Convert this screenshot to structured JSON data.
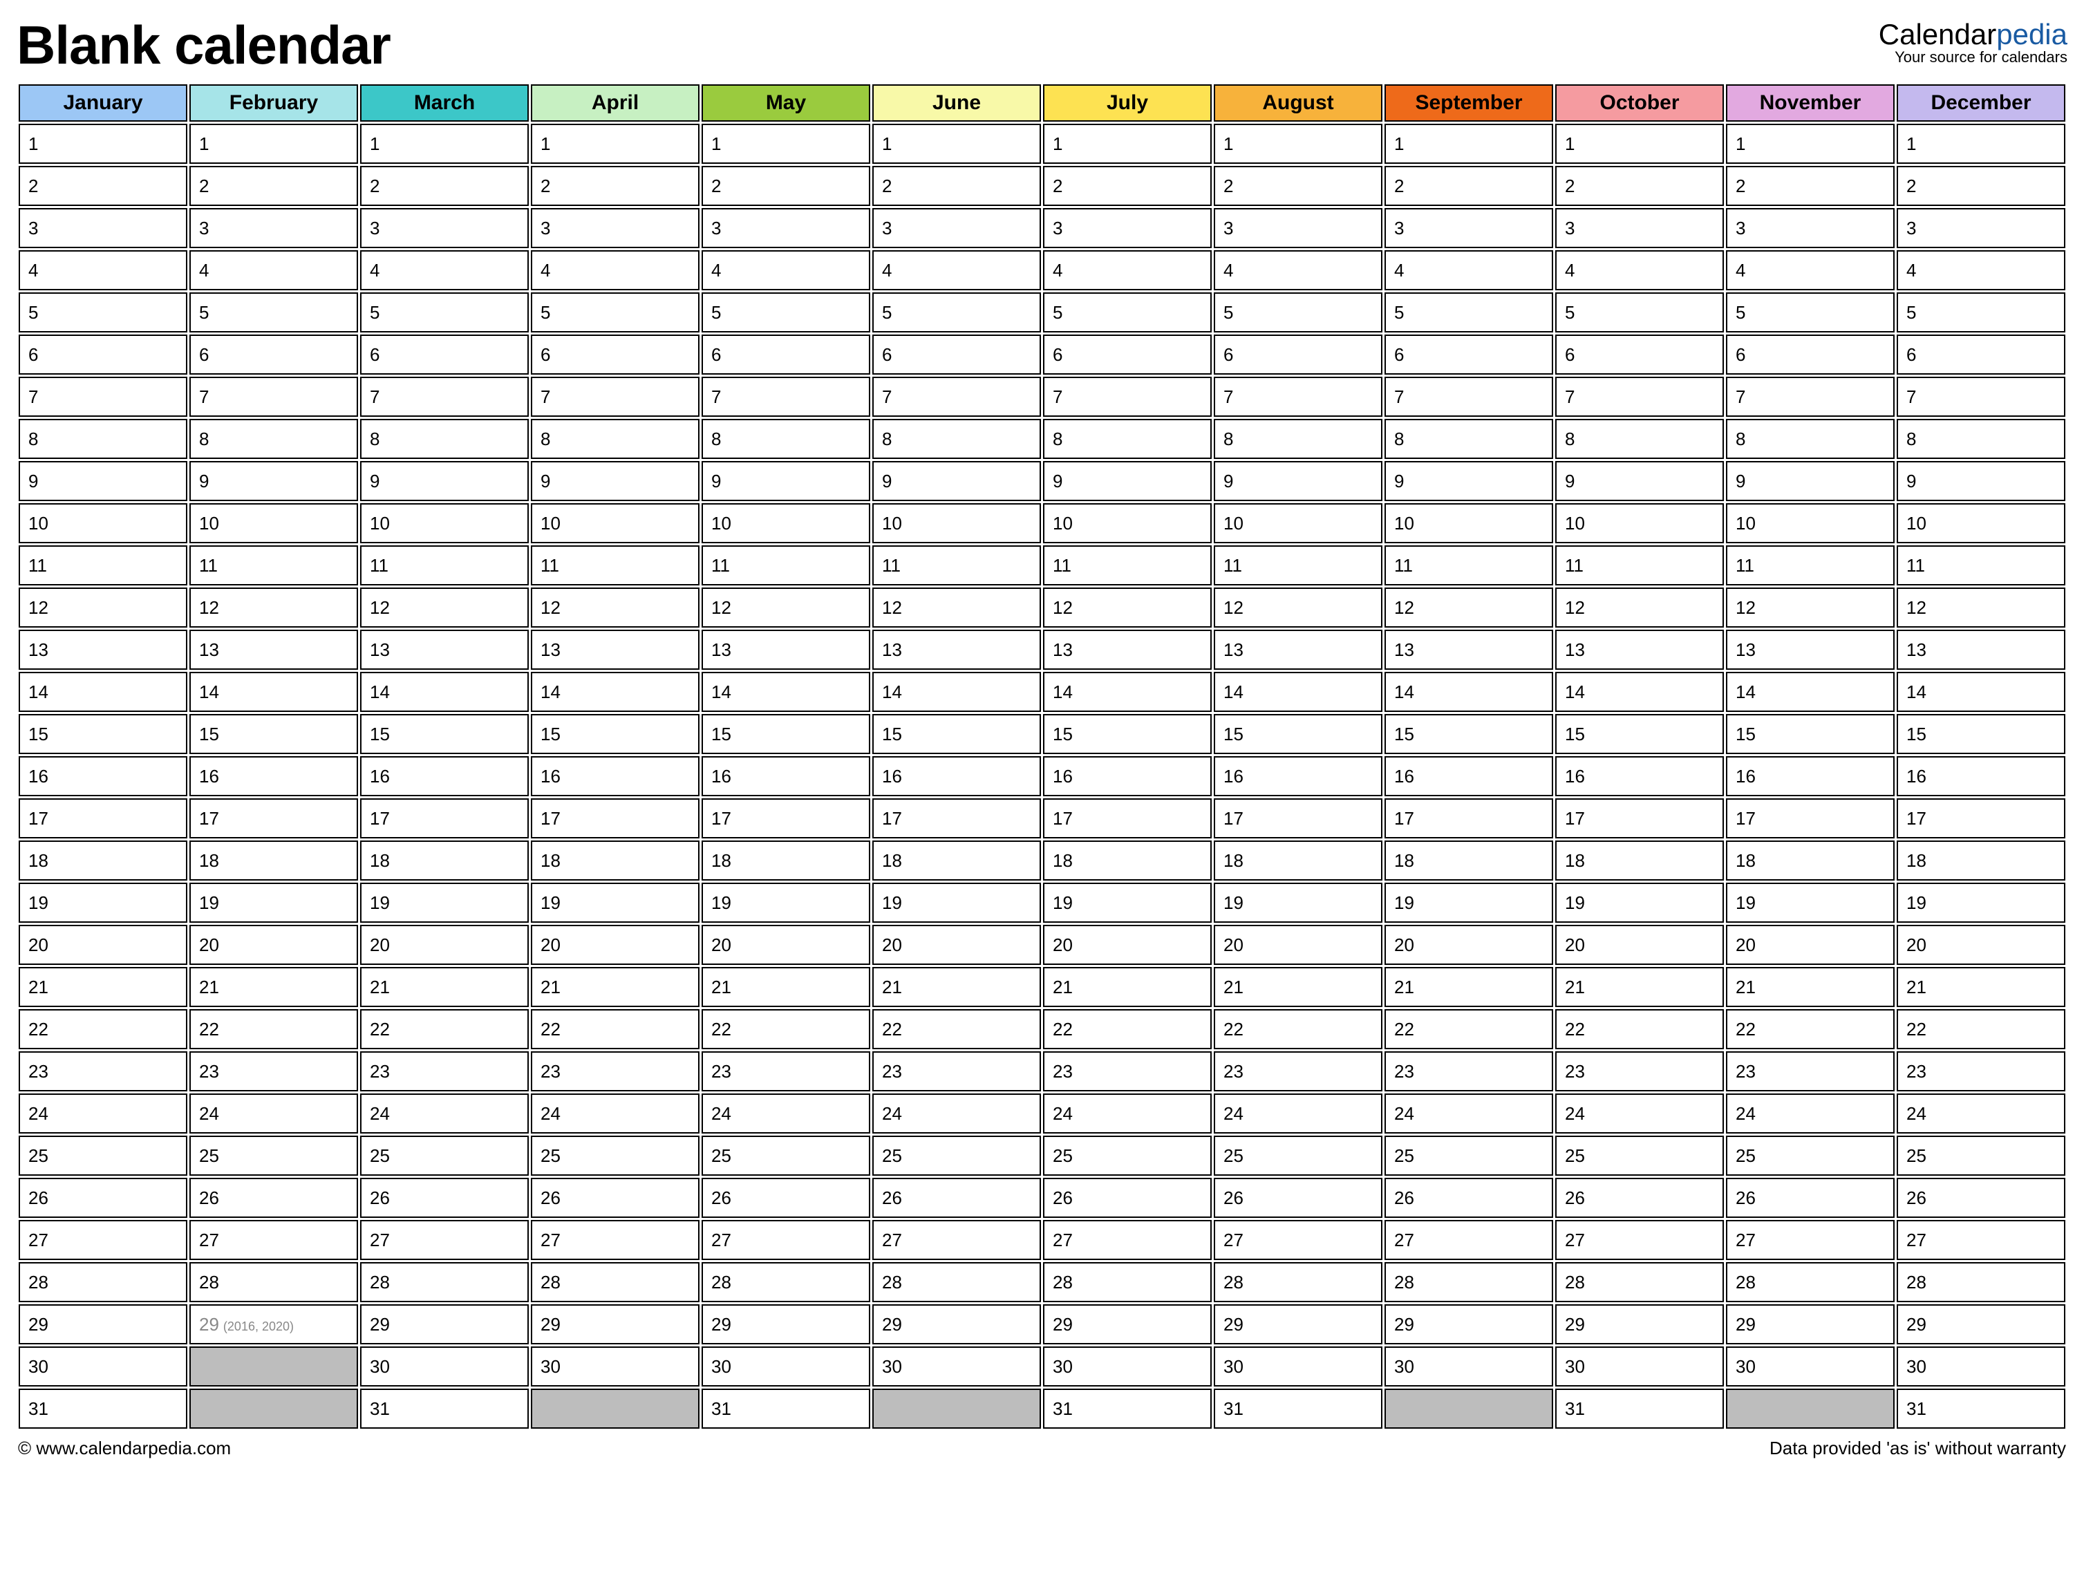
{
  "title": "Blank calendar",
  "brand": {
    "part1": "Calendar",
    "part2": "pedia",
    "tagline": "Your source for calendars"
  },
  "months": [
    {
      "name": "January",
      "days": 31
    },
    {
      "name": "February",
      "days": 29,
      "leap": true,
      "leap_note": "(2016, 2020)"
    },
    {
      "name": "March",
      "days": 31
    },
    {
      "name": "April",
      "days": 30
    },
    {
      "name": "May",
      "days": 31
    },
    {
      "name": "June",
      "days": 30
    },
    {
      "name": "July",
      "days": 31
    },
    {
      "name": "August",
      "days": 31
    },
    {
      "name": "September",
      "days": 30
    },
    {
      "name": "October",
      "days": 31
    },
    {
      "name": "November",
      "days": 30
    },
    {
      "name": "December",
      "days": 31
    }
  ],
  "max_rows": 31,
  "footer": {
    "left": "© www.calendarpedia.com",
    "right": "Data provided 'as is' without warranty"
  }
}
